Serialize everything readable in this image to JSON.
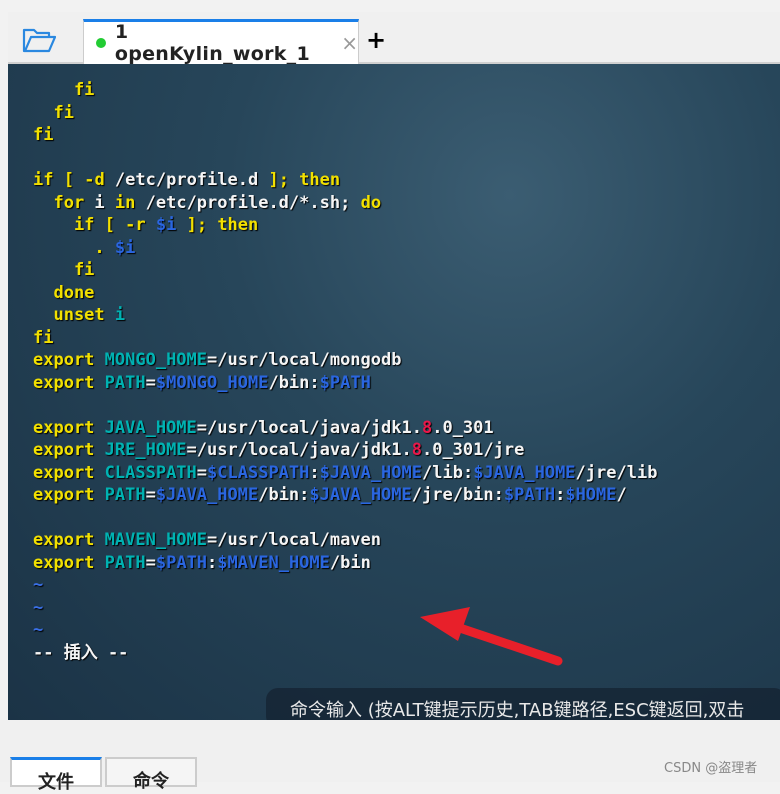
{
  "tabbar": {
    "active_tab": "1 openKylin_work_1",
    "status_color": "#22cc33",
    "close": "×",
    "add": "+"
  },
  "editor": {
    "lines": [
      [
        [
          "    fi",
          "k"
        ]
      ],
      [
        [
          "  fi",
          "k"
        ]
      ],
      [
        [
          "fi",
          "k"
        ]
      ],
      [],
      [
        [
          "if",
          "k"
        ],
        [
          " [ ",
          "k"
        ],
        [
          "-d",
          "k"
        ],
        [
          " /etc/profile.d ",
          "w"
        ],
        [
          "]; ",
          "k"
        ],
        [
          "then",
          "k"
        ]
      ],
      [
        [
          "  for",
          "k"
        ],
        [
          " i ",
          "w"
        ],
        [
          "in",
          "k"
        ],
        [
          " /etc/profile.d/*.sh",
          "w"
        ],
        [
          "; ",
          "w"
        ],
        [
          "do",
          "k"
        ]
      ],
      [
        [
          "    if",
          "k"
        ],
        [
          " [ ",
          "k"
        ],
        [
          "-r",
          "k"
        ],
        [
          " ",
          "w"
        ],
        [
          "$i",
          "d"
        ],
        [
          " ]; ",
          "k"
        ],
        [
          "then",
          "k"
        ]
      ],
      [
        [
          "      . ",
          "k"
        ],
        [
          "$i",
          "d"
        ]
      ],
      [
        [
          "    fi",
          "k"
        ]
      ],
      [
        [
          "  done",
          "k"
        ]
      ],
      [
        [
          "  unset",
          "k"
        ],
        [
          " i",
          "v"
        ]
      ],
      [
        [
          "fi",
          "k"
        ]
      ],
      [
        [
          "export",
          "k"
        ],
        [
          " MONGO_HOME",
          "v"
        ],
        [
          "=/usr/local/mongodb",
          "w"
        ]
      ],
      [
        [
          "export",
          "k"
        ],
        [
          " PATH",
          "v"
        ],
        [
          "=",
          "w"
        ],
        [
          "$MONGO_HOME",
          "d"
        ],
        [
          "/bin:",
          "w"
        ],
        [
          "$PATH",
          "d"
        ]
      ],
      [],
      [
        [
          "export",
          "k"
        ],
        [
          " JAVA_HOME",
          "v"
        ],
        [
          "=/usr/local/java/jdk1.",
          "w"
        ],
        [
          "8",
          "r"
        ],
        [
          ".0_301",
          "w"
        ]
      ],
      [
        [
          "export",
          "k"
        ],
        [
          " JRE_HOME",
          "v"
        ],
        [
          "=/usr/local/java/jdk1.",
          "w"
        ],
        [
          "8",
          "r"
        ],
        [
          ".0_301/jre",
          "w"
        ]
      ],
      [
        [
          "export",
          "k"
        ],
        [
          " CLASSPATH",
          "v"
        ],
        [
          "=",
          "w"
        ],
        [
          "$CLASSPATH",
          "d"
        ],
        [
          ":",
          "w"
        ],
        [
          "$JAVA_HOME",
          "d"
        ],
        [
          "/lib:",
          "w"
        ],
        [
          "$JAVA_HOME",
          "d"
        ],
        [
          "/jre/lib",
          "w"
        ]
      ],
      [
        [
          "export",
          "k"
        ],
        [
          " PATH",
          "v"
        ],
        [
          "=",
          "w"
        ],
        [
          "$JAVA_HOME",
          "d"
        ],
        [
          "/bin:",
          "w"
        ],
        [
          "$JAVA_HOME",
          "d"
        ],
        [
          "/jre/bin:",
          "w"
        ],
        [
          "$PATH",
          "d"
        ],
        [
          ":",
          "w"
        ],
        [
          "$HOME",
          "d"
        ],
        [
          "/",
          "w"
        ]
      ],
      [],
      [
        [
          "export",
          "k"
        ],
        [
          " MAVEN_HOME",
          "v"
        ],
        [
          "=/usr/local/maven",
          "w"
        ]
      ],
      [
        [
          "export",
          "k"
        ],
        [
          " PATH",
          "v"
        ],
        [
          "=",
          "w"
        ],
        [
          "$PATH",
          "d"
        ],
        [
          ":",
          "w"
        ],
        [
          "$MAVEN_HOME",
          "d"
        ],
        [
          "/bin",
          "w"
        ]
      ],
      [
        [
          "~",
          "t"
        ]
      ],
      [
        [
          "~",
          "t"
        ]
      ],
      [
        [
          "~",
          "t"
        ]
      ],
      [
        [
          "-- 插入 --",
          "w"
        ]
      ]
    ],
    "arrow_color": "#e8202a"
  },
  "command_hint": "命令输入 (按ALT键提示历史,TAB键路径,ESC键返回,双击",
  "bottom_tabs": [
    "文件",
    "命令"
  ],
  "watermark": "CSDN @盗理者"
}
